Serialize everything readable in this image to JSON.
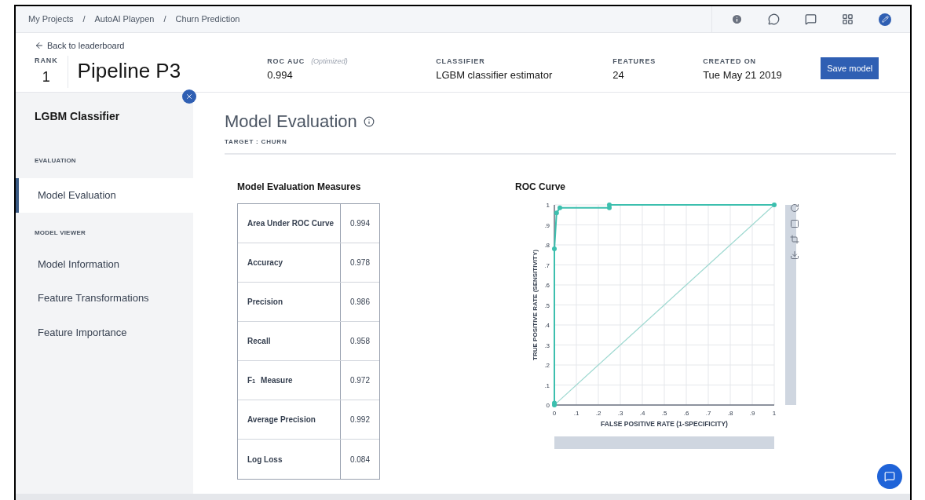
{
  "breadcrumbs": [
    "My Projects",
    "AutoAI Playpen",
    "Churn Prediction"
  ],
  "breadcrumb_separators": [
    "/",
    "/"
  ],
  "back_link": "Back to leaderboard",
  "rank": {
    "label": "RANK",
    "value": "1"
  },
  "pipeline_title": "Pipeline P3",
  "stats": [
    {
      "label": "ROC AUC",
      "note": "(Optimized)",
      "value": "0.994"
    },
    {
      "label": "CLASSIFIER",
      "value": "LGBM classifier estimator"
    },
    {
      "label": "FEATURES",
      "value": "24"
    },
    {
      "label": "CREATED ON",
      "value": "Tue May 21 2019"
    }
  ],
  "save_button": "Save model",
  "sidebar": {
    "title": "LGBM Classifier",
    "sections": [
      {
        "heading": "EVALUATION",
        "items": [
          {
            "label": "Model Evaluation",
            "selected": true
          }
        ]
      },
      {
        "heading": "MODEL VIEWER",
        "items": [
          {
            "label": "Model Information",
            "selected": false
          },
          {
            "label": "Feature Transformations",
            "selected": false
          },
          {
            "label": "Feature Importance",
            "selected": false
          }
        ]
      }
    ]
  },
  "page_title": "Model Evaluation",
  "target": "TARGET : CHURN",
  "measures": {
    "title": "Model Evaluation Measures",
    "rows": [
      {
        "name": "Area Under ROC Curve",
        "value": "0.994"
      },
      {
        "name": "Accuracy",
        "value": "0.978"
      },
      {
        "name": "Precision",
        "value": "0.986"
      },
      {
        "name": "Recall",
        "value": "0.958"
      },
      {
        "name": "F$_{1}$ Measure",
        "value": "0.972"
      },
      {
        "name": "Average Precision",
        "value": "0.992"
      },
      {
        "name": "Log Loss",
        "value": "0.084"
      }
    ]
  },
  "roc": {
    "title": "ROC Curve",
    "chart_data": {
      "type": "line",
      "xlabel": "FALSE POSITIVE RATE (1-SPECIFICITY)",
      "ylabel": "TRUE POSITIVE RATE (SENSITIVITY)",
      "x": [
        0,
        0,
        0,
        0.01,
        0.025,
        0.25,
        0.25,
        1
      ],
      "grid": true,
      "series": [
        {
          "color": "#3cbfae",
          "marker": "circle",
          "values": [
            0,
            0.01,
            0.78,
            0.96,
            0.985,
            0.985,
            1,
            1
          ]
        },
        {
          "color": "#9fd9d1",
          "values": [
            0,
            0,
            0,
            0.01,
            0.025,
            0.25,
            0.25,
            1
          ]
        }
      ],
      "xlim": [
        0,
        1
      ],
      "ylim": [
        0,
        1
      ],
      "xticks": [
        {
          "value": 0,
          "label": "0"
        },
        {
          "value": 0.1,
          "label": ".1"
        },
        {
          "value": 0.2,
          "label": ".2"
        },
        {
          "value": 0.3,
          "label": ".3"
        },
        {
          "value": 0.4,
          "label": ".4"
        },
        {
          "value": 0.5,
          "label": ".5"
        },
        {
          "value": 0.6,
          "label": ".6"
        },
        {
          "value": 0.7,
          "label": ".7"
        },
        {
          "value": 0.8,
          "label": ".8"
        },
        {
          "value": 0.9,
          "label": ".9"
        },
        {
          "value": 1,
          "label": "1"
        }
      ],
      "yticks": [
        {
          "value": 0,
          "label": "0"
        },
        {
          "value": 0.1,
          "label": ".1"
        },
        {
          "value": 0.2,
          "label": ".2"
        },
        {
          "value": 0.3,
          "label": ".3"
        },
        {
          "value": 0.4,
          "label": ".4"
        },
        {
          "value": 0.5,
          "label": ".5"
        },
        {
          "value": 0.6,
          "label": ".6"
        },
        {
          "value": 0.7,
          "label": ".7"
        },
        {
          "value": 0.8,
          "label": ".8"
        },
        {
          "value": 0.9,
          "label": ".9"
        },
        {
          "value": 1,
          "label": "1"
        }
      ]
    }
  }
}
